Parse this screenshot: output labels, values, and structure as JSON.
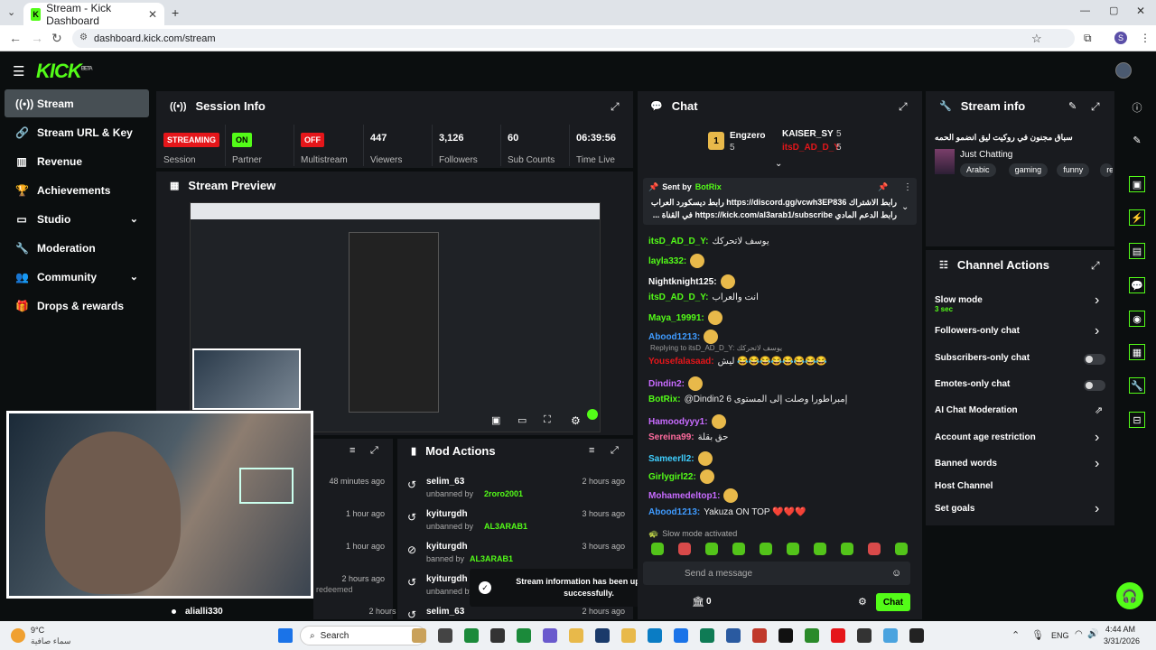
{
  "browser": {
    "tab_title": "Stream - Kick Dashboard",
    "url": "dashboard.kick.com/stream",
    "profile": "S"
  },
  "logo": {
    "text": "KICK",
    "sup": "BETA"
  },
  "sidebar": {
    "items": [
      {
        "label": "Stream",
        "icon": "broadcast-icon"
      },
      {
        "label": "Stream URL & Key",
        "icon": "link-icon"
      },
      {
        "label": "Revenue",
        "icon": "chart-icon"
      },
      {
        "label": "Achievements",
        "icon": "trophy-icon"
      },
      {
        "label": "Studio",
        "icon": "monitor-icon"
      },
      {
        "label": "Moderation",
        "icon": "wrench-icon"
      },
      {
        "label": "Community",
        "icon": "community-icon"
      },
      {
        "label": "Drops & rewards",
        "icon": "gift-icon"
      }
    ]
  },
  "session": {
    "title": "Session Info",
    "stats": [
      {
        "badge": "STREAMING",
        "label": "Session",
        "color": "#e5161a"
      },
      {
        "badge": "ON",
        "label": "Partner",
        "color": "#53fc18"
      },
      {
        "badge": "OFF",
        "label": "Multistream",
        "color": "#e5161a"
      },
      {
        "value": "447",
        "label": "Viewers"
      },
      {
        "value": "3,126",
        "label": "Followers"
      },
      {
        "value": "60",
        "label": "Sub Counts"
      },
      {
        "value": "06:39:56",
        "label": "Time Live"
      }
    ]
  },
  "preview": {
    "title": "Stream Preview"
  },
  "activity": {
    "rows": [
      {
        "time": "48 minutes ago"
      },
      {
        "time": "1 hour ago"
      },
      {
        "time": "1 hour ago"
      },
      {
        "time": "2 hours ago",
        "note": "redeemed"
      },
      {
        "user": "alialli330",
        "time": "2 hours ago"
      }
    ]
  },
  "mod": {
    "title": "Mod Actions",
    "rows": [
      {
        "user": "selim_63",
        "action": "unbanned by",
        "by": "2roro2001",
        "time": "2 hours ago"
      },
      {
        "user": "kyiturgdh",
        "action": "unbanned by",
        "by": "AL3ARAB1",
        "time": "3 hours ago"
      },
      {
        "user": "kyiturgdh",
        "action": "banned by",
        "by": "AL3ARAB1",
        "time": "3 hours ago"
      },
      {
        "user": "kyiturgdh",
        "action": "unbanned by",
        "by": "",
        "time": "3 hours ago"
      },
      {
        "user": "selim_63",
        "action": "",
        "by": "",
        "time": "2 hours ago"
      }
    ]
  },
  "toast": {
    "text": "Stream information has been updated successfully."
  },
  "chat": {
    "title": "Chat",
    "top": [
      {
        "name": "Engzero",
        "count": "5"
      },
      {
        "name": "KAISER_SY",
        "count": "5"
      },
      {
        "name": "itsD_AD_D_Y",
        "count": "5"
      }
    ],
    "pinned": {
      "sent_by": "Sent by",
      "bot": "BotRix",
      "line1": "رابط الاشتراك https://discord.gg/vcwh3EP836 رابط ديسكورد العراب",
      "line2": "رابط الدعم المادي https://kick.com/al3arab1/subscribe في القناة ..."
    },
    "messages": [
      {
        "name": "itsD_AD_D_Y:",
        "text": "يوسف لاتحركك",
        "color": "#53fc18"
      },
      {
        "name": "layla332:",
        "text": "",
        "color": "#53fc18"
      },
      {
        "name": "Nightknight125:",
        "text": "",
        "color": "#fff"
      },
      {
        "name": "itsD_AD_D_Y:",
        "text": "انت والعراب",
        "color": "#53fc18"
      },
      {
        "name": "Maya_19991:",
        "text": "",
        "color": "#53fc18"
      },
      {
        "name": "Abood1213:",
        "text": "",
        "color": "#3f9bff"
      },
      {
        "name": "Yousefalasaad:",
        "text": "ليش 😂😂😂😂😂😂😂😂",
        "color": "#e5161a",
        "reply": "Replying to itsD_AD_D_Y: يوسف لاتحركك"
      },
      {
        "name": "Dindin2:",
        "text": "",
        "color": "#c86bff"
      },
      {
        "name": "BotRix:",
        "text": "@Dindin2 6 إمبراطورا وصلت إلى المستوى",
        "color": "#53fc18"
      },
      {
        "name": "Hamoodyyy1:",
        "text": "",
        "color": "#c86bff"
      },
      {
        "name": "Sereina99:",
        "text": "حق بقلة",
        "color": "#ff6b9e"
      },
      {
        "name": "Sameerll2:",
        "text": "",
        "color": "#3fcfff"
      },
      {
        "name": "Girlygirl22:",
        "text": "",
        "color": "#53fc18"
      },
      {
        "name": "Mohamedeltop1:",
        "text": "",
        "color": "#c86bff"
      },
      {
        "name": "Abood1213:",
        "text": "Yakuza ON TOP ❤️❤️❤️",
        "color": "#3f9bff"
      }
    ],
    "slow_mode": "Slow mode activated",
    "placeholder": "Send a message",
    "points": "0",
    "send": "Chat"
  },
  "stream_info": {
    "title": "Stream info",
    "stream_title": "سباق مجنون في روكيت ليق انضمو الحمه",
    "category": "Just Chatting",
    "tags": [
      "Arabic",
      "gaming",
      "funny",
      "redM"
    ]
  },
  "channel_actions": {
    "title": "Channel Actions",
    "items": [
      {
        "label": "Slow mode",
        "sub": "3 sec",
        "kind": "arrow"
      },
      {
        "label": "Followers-only chat",
        "kind": "arrow"
      },
      {
        "label": "Subscribers-only chat",
        "kind": "toggle"
      },
      {
        "label": "Emotes-only chat",
        "kind": "toggle"
      },
      {
        "label": "AI Chat Moderation",
        "kind": "ext"
      },
      {
        "label": "Account age restriction",
        "kind": "arrow"
      },
      {
        "label": "Banned words",
        "kind": "arrow"
      },
      {
        "label": "Host Channel",
        "kind": "none"
      },
      {
        "label": "Set goals",
        "kind": "arrow"
      }
    ]
  },
  "taskbar": {
    "weather_temp": "9°C",
    "weather_desc": "سماء صافية",
    "search": "Search",
    "lang": "ENG",
    "time": "4:44 AM",
    "date": "3/31/2026"
  },
  "colors": {
    "accent": "#53fc18",
    "panel": "#191b1f",
    "bg": "#0b0e0f"
  }
}
